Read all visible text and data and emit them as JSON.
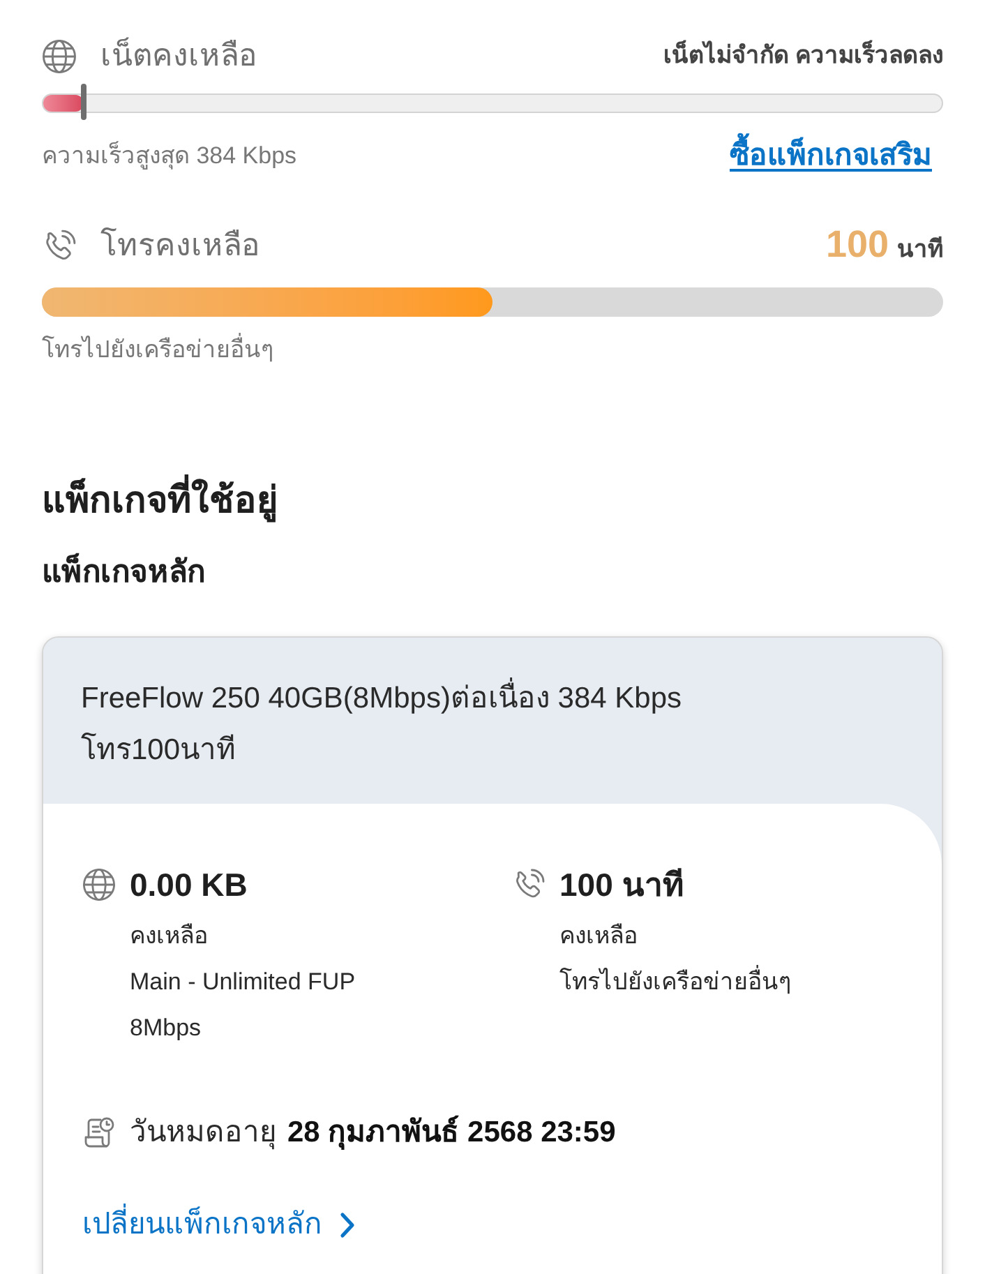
{
  "allowances": [
    {
      "kind": "data",
      "label": "เน็ตคงเหลือ",
      "status": "เน็ตไม่จำกัด ความเร็วลดลง",
      "level": 0.045,
      "note": "ความเร็วสูงสุด 384 Kbps",
      "link": "ซื้อแพ็กเกจเสริม"
    },
    {
      "kind": "voice",
      "label": "โทรคงเหลือ",
      "amount": "100",
      "unit": "นาที",
      "level": 0.5,
      "note": "โทรไปยังเครือข่ายอื่นๆ"
    }
  ],
  "section_title": "แพ็กเกจที่ใช้อยู่",
  "subsection_title": "แพ็กเกจหลัก",
  "package": {
    "name": "FreeFlow 250 40GB(8Mbps)ต่อเนื่อง 384 Kbps โทร100นาที",
    "balances": [
      {
        "kind": "data",
        "amount": "0.00 KB",
        "caption": "คงเหลือ",
        "detail": "Main - Unlimited FUP 8Mbps"
      },
      {
        "kind": "voice",
        "amount": "100 นาที",
        "caption": "คงเหลือ",
        "detail": "โทรไปยังเครือข่ายอื่นๆ"
      }
    ],
    "expiry": {
      "label": "วันหมดอายุ",
      "value": "28 กุมภาพันธ์ 2568 23:59"
    },
    "change_link": "เปลี่ยนแพ็กเกจหลัก"
  }
}
